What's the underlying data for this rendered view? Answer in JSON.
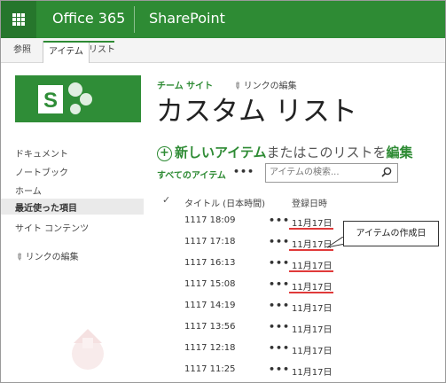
{
  "suite": {
    "brand": "Office 365",
    "app": "SharePoint",
    "icon": "waffle-icon",
    "color": "#2e8b34"
  },
  "ribbon": {
    "tabs": [
      "参照",
      "アイテム",
      "リスト"
    ]
  },
  "logo": {
    "letter": "S"
  },
  "nav": {
    "items": [
      "ドキュメント",
      "ノートブック",
      "ホーム",
      "最近使った項目",
      "サイト コンテンツ"
    ],
    "edit_links": "リンクの編集"
  },
  "header": {
    "breadcrumb": "チーム サイト",
    "edit_links": "リンクの編集",
    "title": "カスタム リスト"
  },
  "command": {
    "new_item": "新しいアイテム",
    "or_edit": "またはこのリストを",
    "edit": "編集"
  },
  "view": {
    "all_items": "すべてのアイテム",
    "more": "•••",
    "search_placeholder": "アイテムの検索..."
  },
  "table": {
    "columns": [
      "タイトル (日本時間)",
      "登録日時"
    ],
    "rows": [
      {
        "title": "1117 18:09",
        "date": "11月17日"
      },
      {
        "title": "1117 17:18",
        "date": "11月17日"
      },
      {
        "title": "1117 16:13",
        "date": "11月17日"
      },
      {
        "title": "1117 15:08",
        "date": "11月17日"
      },
      {
        "title": "1117 14:19",
        "date": "11月17日"
      },
      {
        "title": "1117 13:56",
        "date": "11月17日"
      },
      {
        "title": "1117 12:18",
        "date": "11月17日"
      },
      {
        "title": "1117 11:25",
        "date": "11月17日"
      }
    ]
  },
  "callout": {
    "text": "アイテムの作成日"
  }
}
